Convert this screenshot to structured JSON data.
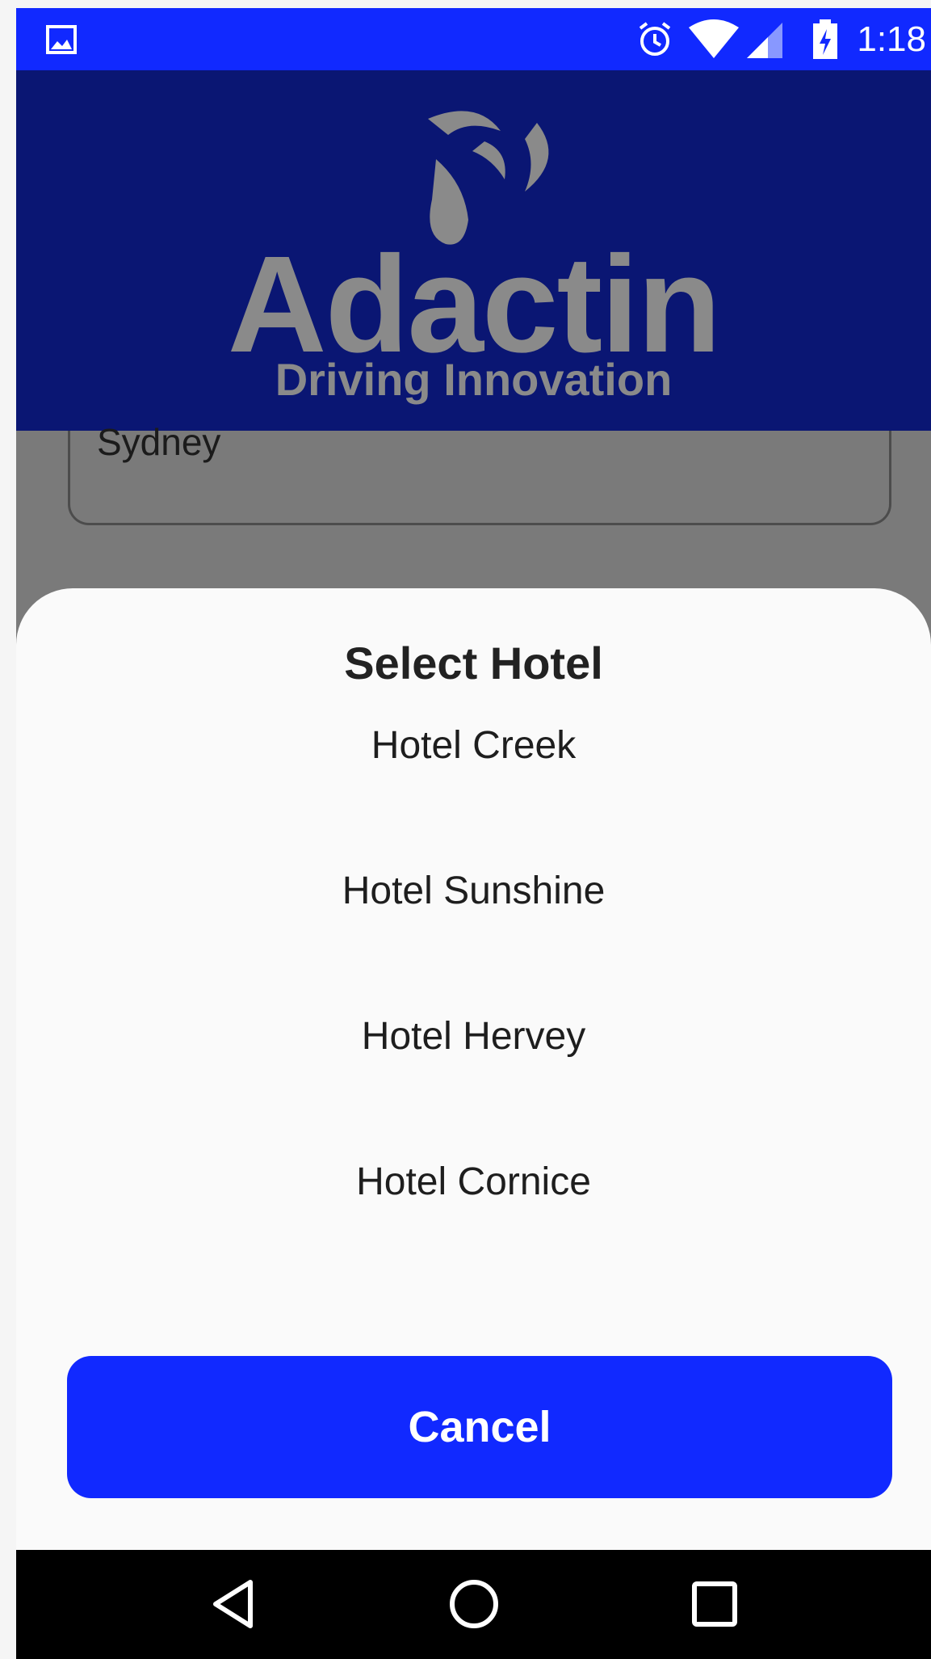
{
  "status_bar": {
    "time": "1:18",
    "icons": [
      "image-icon",
      "alarm-icon",
      "wifi-icon",
      "signal-icon",
      "battery-charging-icon"
    ]
  },
  "header": {
    "logo_name": "Adactin",
    "logo_tagline": "Driving Innovation"
  },
  "form": {
    "location_value": "Sydney"
  },
  "sheet": {
    "title": "Select Hotel",
    "options": [
      "Hotel Creek",
      "Hotel Sunshine",
      "Hotel Hervey",
      "Hotel Cornice"
    ],
    "cancel_label": "Cancel"
  },
  "nav_bar": {
    "icons": [
      "back-icon",
      "home-icon",
      "recents-icon"
    ]
  },
  "colors": {
    "status_bar": "#1129ff",
    "header": "#0a1673",
    "accent": "#1129ff",
    "logo": "#8a8a8a"
  }
}
